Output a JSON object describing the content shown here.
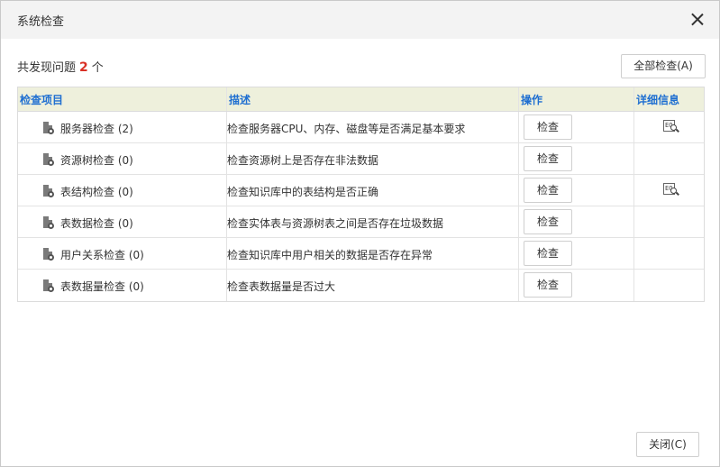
{
  "dialog": {
    "title": "系统检查",
    "close_icon": "close-icon"
  },
  "summary": {
    "prefix": "共发现问题",
    "count": "2",
    "suffix": "个"
  },
  "toolbar": {
    "check_all_label": "全部检查(A)"
  },
  "table": {
    "headers": {
      "item": "检查项目",
      "desc": "描述",
      "action": "操作",
      "detail": "详细信息"
    },
    "rows": [
      {
        "name": "服务器检查 (2)",
        "desc": "检查服务器CPU、内存、磁盘等是否满足基本要求",
        "action": "检查",
        "has_detail": true
      },
      {
        "name": "资源树检查 (0)",
        "desc": "检查资源树上是否存在非法数据",
        "action": "检查",
        "has_detail": false
      },
      {
        "name": "表结构检查 (0)",
        "desc": "检查知识库中的表结构是否正确",
        "action": "检查",
        "has_detail": true
      },
      {
        "name": "表数据检查 (0)",
        "desc": "检查实体表与资源树表之间是否存在垃圾数据",
        "action": "检查",
        "has_detail": false
      },
      {
        "name": "用户关系检查 (0)",
        "desc": "检查知识库中用户相关的数据是否存在异常",
        "action": "检查",
        "has_detail": false
      },
      {
        "name": "表数据量检查 (0)",
        "desc": "检查表数据量是否过大",
        "action": "检查",
        "has_detail": false
      }
    ],
    "detail_icon_text": "EQ"
  },
  "footer": {
    "close_label": "关闭(C)"
  },
  "colors": {
    "header_bg": "#eef0dc",
    "header_text": "#1f6fd1",
    "count_red": "#d93025",
    "titlebar_bg": "#f3f3f3"
  }
}
